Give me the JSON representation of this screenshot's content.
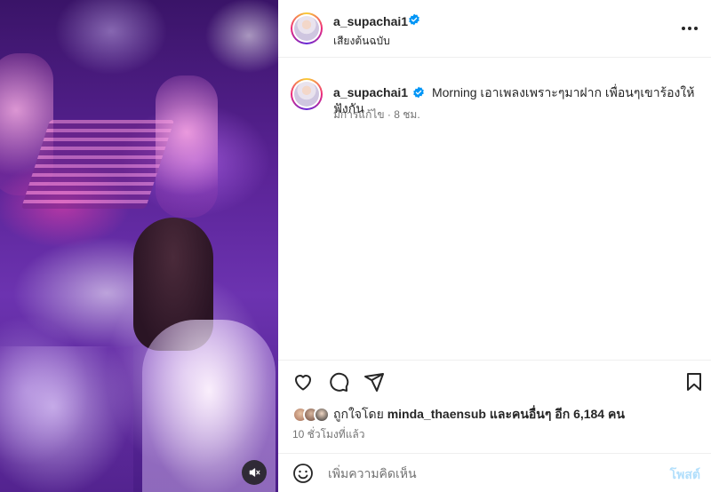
{
  "post": {
    "author": "a_supachai1",
    "audio_label": "เสียงต้นฉบับ",
    "caption": {
      "author": "a_supachai1",
      "text": "Morning เอาเพลงเพราะๆมาฝาก เพื่อนๆเขาร้องให้ฟังกัน",
      "edited_meta": "มีการแก้ไข · 8 ชม."
    },
    "likes": {
      "prefix": "ถูกใจโดย",
      "user": "minda_thaensub",
      "suffix": "และคนอื่นๆ อีก 6,184 คน"
    },
    "timestamp": "10 ชั่วโมงที่แล้ว"
  },
  "comment": {
    "placeholder": "เพิ่มความคิดเห็น",
    "post_label": "โพสต์"
  },
  "colors": {
    "verified": "#0095f6",
    "post_button_disabled": "#b2dffc",
    "meta_text": "#737373"
  },
  "icons": [
    "mute-icon",
    "more-icon",
    "heart-icon",
    "comment-icon",
    "share-icon",
    "bookmark-icon",
    "emoji-icon",
    "verified-icon"
  ]
}
